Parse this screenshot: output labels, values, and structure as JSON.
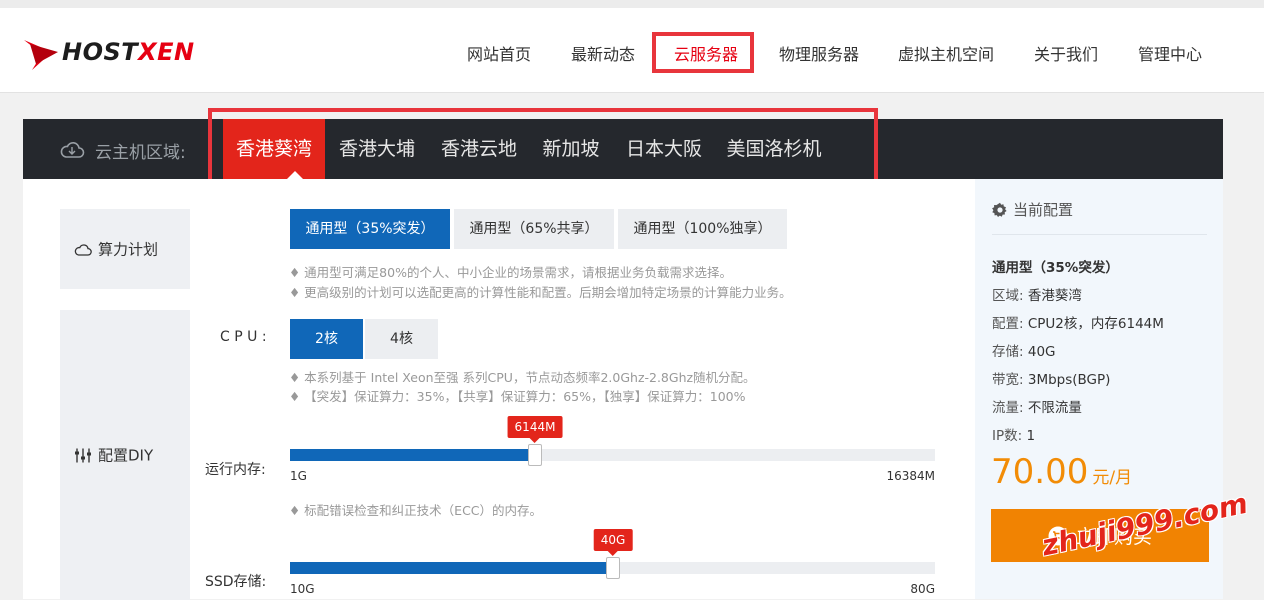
{
  "brand": {
    "logo_text_a": "HOST",
    "logo_text_b": "XEN",
    "accent": "#e3251b",
    "primary": "#1067b8",
    "buy_color": "#f18302"
  },
  "nav": {
    "items": [
      {
        "label": "网站首页"
      },
      {
        "label": "最新动态"
      },
      {
        "label": "云服务器",
        "active": true
      },
      {
        "label": "物理服务器"
      },
      {
        "label": "虚拟主机空间"
      },
      {
        "label": "关于我们"
      },
      {
        "label": "管理中心"
      }
    ]
  },
  "region": {
    "label": "云主机区域:",
    "icon": "cloud-icon",
    "tabs": [
      {
        "label": "香港葵湾",
        "active": true
      },
      {
        "label": "香港大埔"
      },
      {
        "label": "香港云地"
      },
      {
        "label": "新加坡"
      },
      {
        "label": "日本大阪"
      },
      {
        "label": "美国洛杉机"
      }
    ]
  },
  "plan": {
    "label": "算力计划",
    "icon": "cloud-outline-icon",
    "options": [
      {
        "label": "通用型（35%突发）",
        "selected": true
      },
      {
        "label": "通用型（65%共享）"
      },
      {
        "label": "通用型（100%独享）"
      }
    ],
    "notes": [
      "♦ 通用型可满足80%的个人、中小企业的场景需求，请根据业务负载需求选择。",
      "♦ 更高级别的计划可以选配更高的计算性能和配置。后期会增加特定场景的计算能力业务。"
    ]
  },
  "diy": {
    "label": "配置DIY",
    "icon": "sliders-icon",
    "cpu": {
      "label": "C P U :",
      "options": [
        {
          "label": "2核",
          "selected": true
        },
        {
          "label": "4核"
        }
      ],
      "notes": [
        "♦ 本系列基于 Intel Xeon至强 系列CPU，节点动态频率2.0Ghz-2.8Ghz随机分配。",
        "♦ 【突发】保证算力：35%，【共享】保证算力：65%，【独享】保证算力：100%"
      ]
    },
    "memory": {
      "label": "运行内存:",
      "value": "6144M",
      "fraction": 0.38,
      "min": "1G",
      "max": "16384M",
      "note": "♦ 标配错误检查和纠正技术（ECC）的内存。"
    },
    "ssd": {
      "label": "SSD存储:",
      "value": "40G",
      "fraction": 0.5,
      "min": "10G",
      "max": "80G"
    }
  },
  "summary": {
    "title": "当前配置",
    "icon": "gear-icon",
    "plan": "通用型（35%突发）",
    "rows": [
      {
        "k": "区域:",
        "v": "香港葵湾"
      },
      {
        "k": "配置:",
        "v": "CPU2核，内存6144M"
      },
      {
        "k": "存储:",
        "v": "40G"
      },
      {
        "k": "带宽:",
        "v": "3Mbps(BGP)"
      },
      {
        "k": "流量:",
        "v": "不限流量"
      },
      {
        "k": "IP数:",
        "v": "1"
      }
    ],
    "price": "70.00",
    "unit": "元/月",
    "buy_label": "立即购买",
    "buy_icon": "cart-icon"
  },
  "watermark": "zhuji999.com"
}
